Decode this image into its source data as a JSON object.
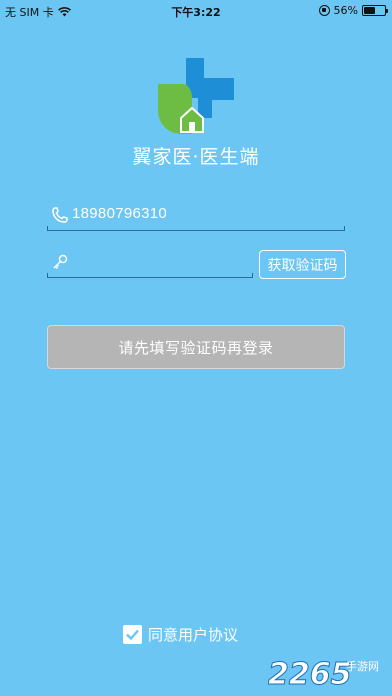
{
  "status_bar": {
    "carrier": "无 SIM 卡",
    "time": "下午3:22",
    "battery_percent": "56%",
    "battery_level": 0.56
  },
  "app": {
    "title": "翼家医·医生端"
  },
  "login": {
    "phone_value": "18980796310",
    "code_placeholder": "",
    "get_code_label": "获取验证码",
    "login_label": "请先填写验证码再登录"
  },
  "agreement": {
    "label": "同意用户协议",
    "checked": true
  },
  "watermark": {
    "number": "2265",
    "suffix": "手游网"
  },
  "colors": {
    "background": "#6cc6f3",
    "logo_blue": "#1e8fd6",
    "logo_green": "#6dbd45",
    "disabled_button": "#b5b5b5"
  },
  "icons": [
    "wifi-icon",
    "rotation-lock-icon",
    "battery-icon",
    "phone-icon",
    "key-icon",
    "checkmark-icon"
  ]
}
